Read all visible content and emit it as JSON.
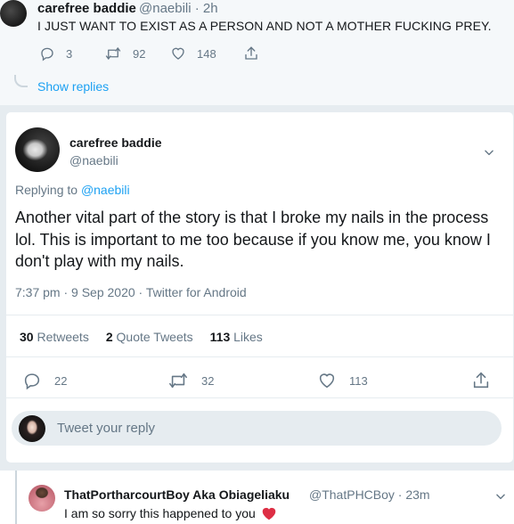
{
  "top_tweet": {
    "name": "carefree baddie",
    "handle_time": "@naebili · 2h",
    "text": "I JUST WANT TO EXIST AS A PERSON AND NOT A MOTHER FUCKING PREY.",
    "replies": "3",
    "retweets": "92",
    "likes": "148",
    "show_replies": "Show replies"
  },
  "main_tweet": {
    "name": "carefree baddie",
    "handle": "@naebili",
    "replying_prefix": "Replying to ",
    "replying_to": "@naebili",
    "text": "Another vital part of the story is that I broke my nails in the process lol. This is important to me too because if you know me, you know I don't play with my nails.",
    "meta": "7:37 pm · 9 Sep 2020 · Twitter for Android",
    "stats": {
      "retweets_count": "30",
      "retweets_label": " Retweets",
      "quote_count": "2",
      "quote_label": " Quote Tweets",
      "likes_count": "113",
      "likes_label": " Likes"
    },
    "actions": {
      "replies": "22",
      "retweets": "32",
      "likes": "113"
    },
    "reply_placeholder": "Tweet your reply"
  },
  "bottom_reply": {
    "name": "ThatPortharcourtBoy Aka Obiageliaku",
    "handle_time": "@ThatPHCBoy · 23m",
    "text": "I am so sorry this happened to you"
  },
  "colors": {
    "accent": "#1da1f2",
    "secondary_text": "#657786",
    "heart": "#e0245e"
  }
}
